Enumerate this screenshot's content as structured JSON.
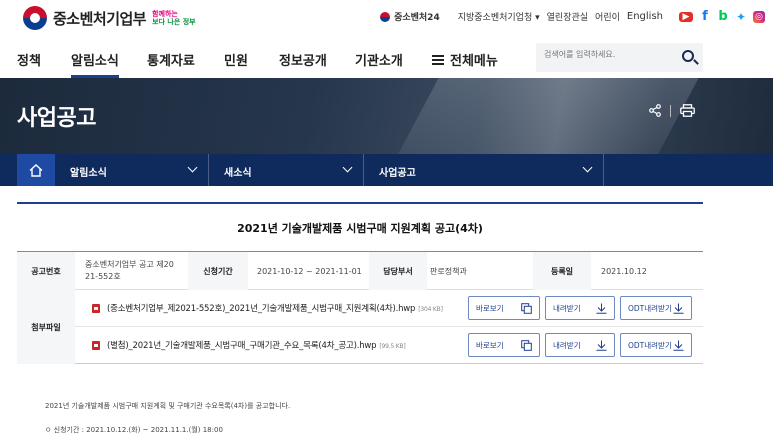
{
  "header": {
    "logo_text": "중소벤처기업부",
    "logo_slogan_top": "함께하는",
    "logo_slogan_bottom": "보다 나은 정부",
    "utility": {
      "site24": "중소벤처24",
      "agency": "지방중소벤처기업청",
      "open_office": "열린장관실",
      "kids": "어린이",
      "english": "English"
    },
    "sns": [
      "youtube-icon",
      "facebook-icon",
      "blog-icon",
      "twitter-icon",
      "instagram-icon"
    ]
  },
  "gnb": {
    "items": [
      "정책",
      "알림소식",
      "통계자료",
      "민원",
      "정보공개",
      "기관소개"
    ],
    "all_menu": "전체메뉴",
    "active": "알림소식",
    "search_placeholder": "검색어를 입력하세요."
  },
  "hero": {
    "title": "사업공고"
  },
  "location": {
    "depth1": "알림소식",
    "depth2": "새소식",
    "depth3": "사업공고"
  },
  "post": {
    "title": "2021년 기술개발제품 시범구매 지원계획 공고(4차)",
    "labels": {
      "number": "공고번호",
      "period": "신청기간",
      "department": "담당부서",
      "registered": "등록일",
      "attachments": "첨부파일"
    },
    "number_line1": "중소벤처기업부 공고 제20",
    "number_line2": "21-552호",
    "period": "2021-10-12 ~ 2021-11-01",
    "department": "판로정책과",
    "registered": "2021.10.12",
    "files": [
      {
        "name": "(중소벤처기업부_제2021-552호)_2021년_기술개발제품_시범구매_지원계획(4차).hwp",
        "size": "[304 KB]"
      },
      {
        "name": "(별첨)_2021년_기술개발제품_시범구매_구매기관_수요_목록(4차_공고).hwp",
        "size": "[99.5 KB]"
      }
    ],
    "buttons": {
      "view": "바로보기",
      "download": "내려받기",
      "odt": "ODT내려받기"
    },
    "body": "2021년 기술개발제품 시범구매 지원계획 및 구매기관 수요목록(4차)를 공고합니다.",
    "apply_period": "ㅇ 신청기간 : 2021.10.12.(화) ~ 2021.11.1.(월) 18:00"
  },
  "colors": {
    "primary": "#1d3f8f",
    "location_bar": "#0f2a5c",
    "home_button": "#1e4aa3"
  }
}
